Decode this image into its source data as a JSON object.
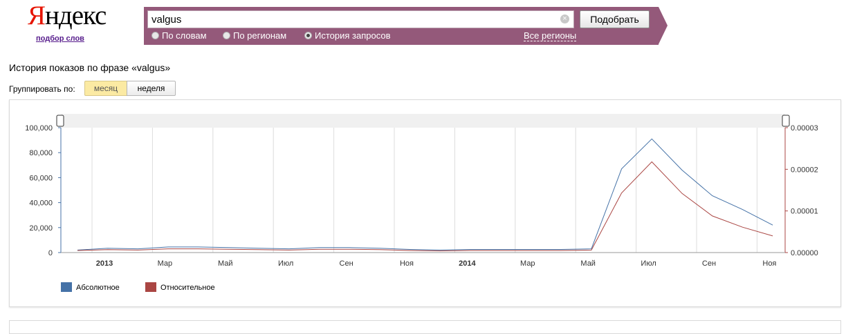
{
  "logo": {
    "text_first": "Я",
    "text_rest": "ндекс",
    "subtitle": "подбор слов"
  },
  "search": {
    "value": "valgus",
    "submit_label": "Подобрать",
    "clear_glyph": "×"
  },
  "modes": [
    {
      "label": "По словам",
      "selected": false
    },
    {
      "label": "По регионам",
      "selected": false
    },
    {
      "label": "История запросов",
      "selected": true
    }
  ],
  "regions_link": "Все регионы",
  "heading": "История показов по фразе «valgus»",
  "grouping": {
    "label": "Группировать по:",
    "month": "месяц",
    "week": "неделя"
  },
  "colors": {
    "bar": "#94597a",
    "absolute": "#4572a7",
    "relative": "#aa4643"
  },
  "chart_data": {
    "type": "line",
    "x": [
      "2012-12",
      "2013-01",
      "2013-02",
      "2013-03",
      "2013-04",
      "2013-05",
      "2013-06",
      "2013-07",
      "2013-08",
      "2013-09",
      "2013-10",
      "2013-11",
      "2013-12",
      "2014-01",
      "2014-02",
      "2014-03",
      "2014-04",
      "2014-05",
      "2014-06",
      "2014-07",
      "2014-08",
      "2014-09",
      "2014-10",
      "2014-11"
    ],
    "x_tick_labels": [
      "2013",
      "Мар",
      "Май",
      "Июл",
      "Сен",
      "Ноя",
      "2014",
      "Мар",
      "Май",
      "Июл",
      "Сен",
      "Ноя"
    ],
    "y_left": {
      "ticks": [
        "0",
        "20,000",
        "40,000",
        "60,000",
        "80,000",
        "100,000"
      ],
      "ylim": [
        0,
        100000
      ]
    },
    "y_right": {
      "ticks": [
        "0.00000",
        "0.00001",
        "0.00002",
        "0.00003"
      ],
      "ylim": [
        0,
        3e-05
      ]
    },
    "series": [
      {
        "name": "Абсолютное",
        "axis": "left",
        "color": "#4572a7",
        "values": [
          2000,
          3500,
          3000,
          4500,
          4500,
          4000,
          3500,
          3000,
          4000,
          4000,
          3500,
          2500,
          2000,
          2500,
          2500,
          2500,
          2500,
          3000,
          67000,
          91000,
          66000,
          45500,
          34500,
          22000
        ]
      },
      {
        "name": "Относительное",
        "axis": "right",
        "color": "#aa4643",
        "values": [
          5e-07,
          7e-07,
          6e-07,
          9e-07,
          9e-07,
          8e-07,
          7e-07,
          6e-07,
          8e-07,
          8e-07,
          7e-07,
          5e-07,
          4e-07,
          5e-07,
          5e-07,
          5e-07,
          5e-07,
          6e-07,
          1.43e-05,
          2.18e-05,
          1.42e-05,
          8.8e-06,
          6.1e-06,
          4e-06
        ]
      }
    ],
    "legend": "bottom-left",
    "grid": "vertical"
  }
}
